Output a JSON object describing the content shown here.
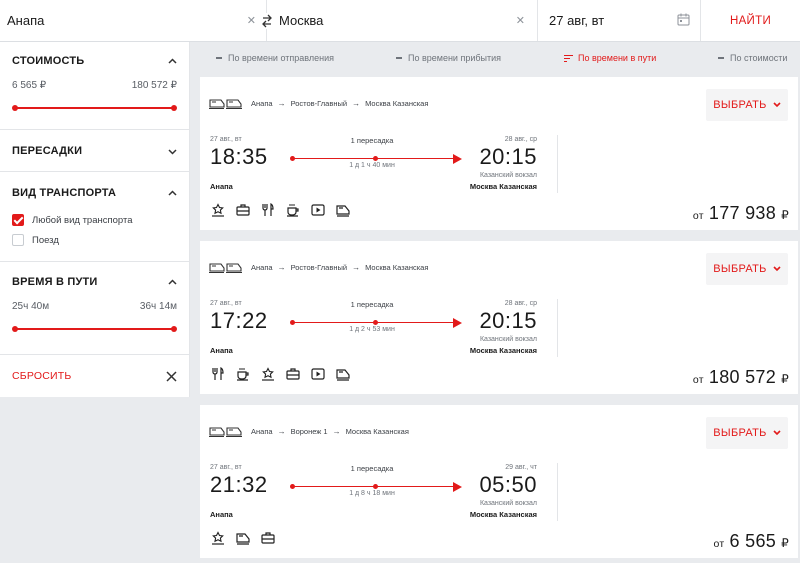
{
  "search": {
    "from": "Анапа",
    "to": "Москва",
    "date": "27 авг, вт",
    "find_label": "НАЙТИ"
  },
  "filters": {
    "cost": {
      "title": "СТОИМОСТЬ",
      "min": "6 565 ₽",
      "max": "180 572 ₽"
    },
    "transfers": {
      "title": "ПЕРЕСАДКИ"
    },
    "transport": {
      "title": "ВИД ТРАНСПОРТА",
      "options": [
        {
          "label": "Любой вид транспорта",
          "checked": true
        },
        {
          "label": "Поезд",
          "checked": false
        }
      ]
    },
    "travel_time": {
      "title": "ВРЕМЯ В ПУТИ",
      "min": "25ч 40м",
      "max": "36ч 14м"
    },
    "reset_label": "СБРОСИТЬ"
  },
  "sort": {
    "options": [
      "По времени отправления",
      "По времени прибытия",
      "По времени в пути",
      "По стоимости"
    ],
    "active": "По времени в пути"
  },
  "results": [
    {
      "route": [
        "Анапа",
        "Ростов-Главный",
        "Москва Казанская"
      ],
      "choose_label": "ВЫБРАТЬ",
      "dep_date": "27 авг., вт",
      "dep_time": "18:35",
      "dep_city": "Анапа",
      "transfers": "1 пересадка",
      "duration": "1 д 1 ч 40 мин",
      "arr_date": "28 авг., ср",
      "arr_time": "20:15",
      "arr_station": "Казанский вокзал",
      "arr_city": "Москва Казанская",
      "amenities": [
        "medal-icon",
        "briefcase-icon",
        "fork-knife-icon",
        "coffee-icon",
        "video-icon",
        "train-icon"
      ],
      "price_from": "от",
      "price": "177 938",
      "currency": "₽"
    },
    {
      "route": [
        "Анапа",
        "Ростов-Главный",
        "Москва Казанская"
      ],
      "choose_label": "ВЫБРАТЬ",
      "dep_date": "27 авг., вт",
      "dep_time": "17:22",
      "dep_city": "Анапа",
      "transfers": "1 пересадка",
      "duration": "1 д 2 ч 53 мин",
      "arr_date": "28 авг., ср",
      "arr_time": "20:15",
      "arr_station": "Казанский вокзал",
      "arr_city": "Москва Казанская",
      "amenities": [
        "fork-knife-icon",
        "coffee-icon",
        "medal-icon",
        "briefcase-icon",
        "video-icon",
        "train-icon"
      ],
      "price_from": "от",
      "price": "180 572",
      "currency": "₽"
    },
    {
      "route": [
        "Анапа",
        "Воронеж 1",
        "Москва Казанская"
      ],
      "choose_label": "ВЫБРАТЬ",
      "dep_date": "27 авг., вт",
      "dep_time": "21:32",
      "dep_city": "Анапа",
      "transfers": "1 пересадка",
      "duration": "1 д 8 ч 18 мин",
      "arr_date": "29 авг., чт",
      "arr_time": "05:50",
      "arr_station": "Казанский вокзал",
      "arr_city": "Москва Казанская",
      "amenities": [
        "medal-icon",
        "train-icon",
        "briefcase-icon"
      ],
      "price_from": "от",
      "price": "6 565",
      "currency": "₽"
    }
  ],
  "colors": {
    "accent": "#e21a1a",
    "background": "#e9ebee"
  }
}
